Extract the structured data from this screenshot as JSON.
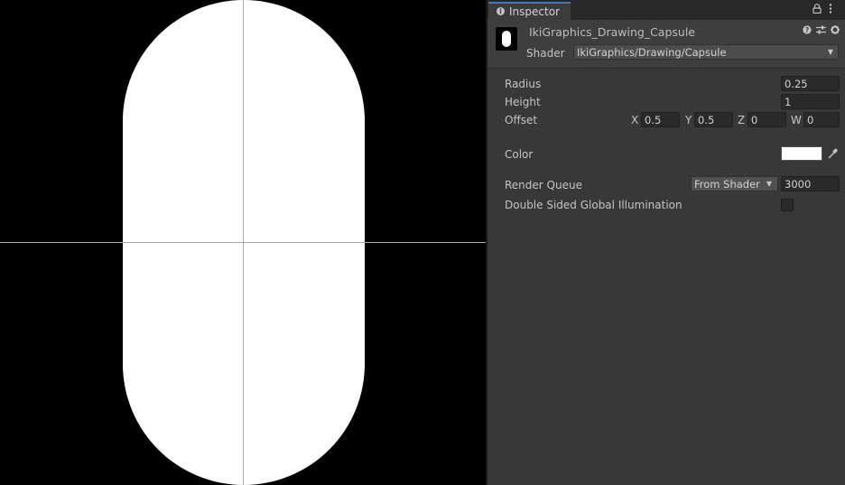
{
  "inspector": {
    "tab_label": "Inspector",
    "tab_icon": "info-icon",
    "lock_icon": "lock-icon",
    "menu_icon": "kebab-menu-icon"
  },
  "material": {
    "name": "IkiGraphics_Drawing_Capsule",
    "shader_label": "Shader",
    "shader_value": "IkiGraphics/Drawing/Capsule",
    "help_icon": "help-icon",
    "presets_icon": "presets-icon",
    "settings_icon": "gear-icon"
  },
  "properties": {
    "radius": {
      "label": "Radius",
      "value": "0.25"
    },
    "height": {
      "label": "Height",
      "value": "1"
    },
    "offset": {
      "label": "Offset",
      "x_label": "X",
      "x": "0.5",
      "y_label": "Y",
      "y": "0.5",
      "z_label": "Z",
      "z": "0",
      "w_label": "W",
      "w": "0"
    },
    "color": {
      "label": "Color",
      "value_hex": "#ffffff"
    },
    "render_queue": {
      "label": "Render Queue",
      "mode": "From Shader",
      "value": "3000"
    },
    "dsgi": {
      "label": "Double Sided Global Illumination",
      "checked": false
    }
  },
  "colors": {
    "scene_background": "#000000",
    "capsule_fill": "#ffffff",
    "crosshair": "#aaaaaa",
    "tab_accent": "#3a79bb"
  }
}
